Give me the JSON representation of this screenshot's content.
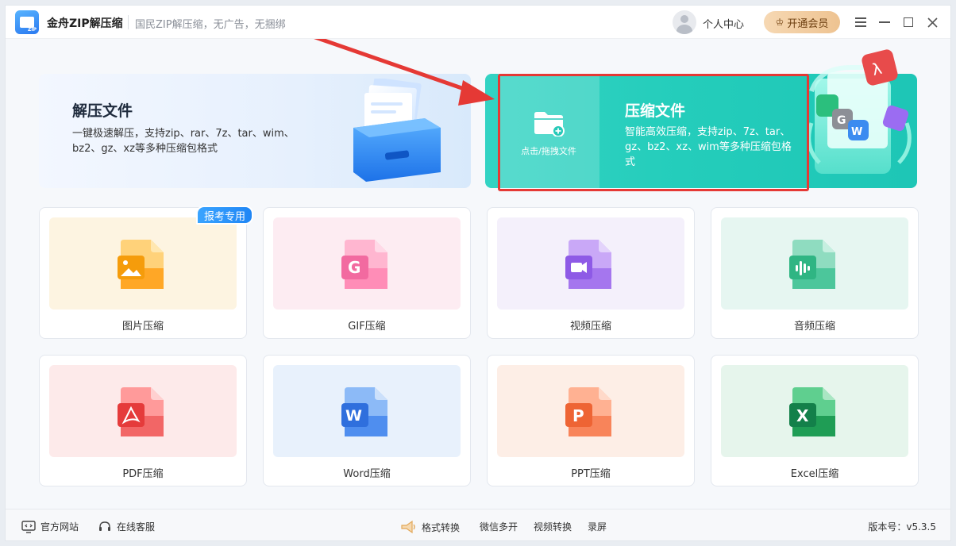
{
  "titlebar": {
    "app_name": "金舟ZIP解压缩",
    "slogan": "国民ZIP解压缩，无广告，无捆绑",
    "user_center": "个人中心",
    "vip_button": "开通会员"
  },
  "hero": {
    "decompress": {
      "title": "解压文件",
      "desc": "一键极速解压，支持zip、rar、7z、tar、wim、bz2、gz、xz等多种压缩包格式"
    },
    "compress": {
      "drop_label": "点击/拖拽文件",
      "title": "压缩文件",
      "desc": "智能高效压缩，支持zip、7z、tar、gz、bz2、xz、wim等多种压缩包格式"
    }
  },
  "tools": {
    "badge": "报考专用",
    "items": [
      {
        "label": "图片压缩",
        "icon": "image-file-icon"
      },
      {
        "label": "GIF压缩",
        "icon": "gif-file-icon"
      },
      {
        "label": "视频压缩",
        "icon": "video-file-icon"
      },
      {
        "label": "音频压缩",
        "icon": "audio-file-icon"
      },
      {
        "label": "PDF压缩",
        "icon": "pdf-file-icon"
      },
      {
        "label": "Word压缩",
        "icon": "word-file-icon"
      },
      {
        "label": "PPT压缩",
        "icon": "ppt-file-icon"
      },
      {
        "label": "Excel压缩",
        "icon": "excel-file-icon"
      }
    ]
  },
  "footer": {
    "official_site": "官方网站",
    "online_service": "在线客服",
    "format_convert": "格式转换",
    "wechat_multi": "微信多开",
    "video_convert": "视频转换",
    "screen_record": "录屏",
    "version": "版本号：v5.3.5"
  },
  "colors": {
    "compress_teal": "#24cdbb",
    "highlight_red": "#e53935",
    "vip_gold": "#eec391",
    "badge_blue": "#1f86f5"
  }
}
